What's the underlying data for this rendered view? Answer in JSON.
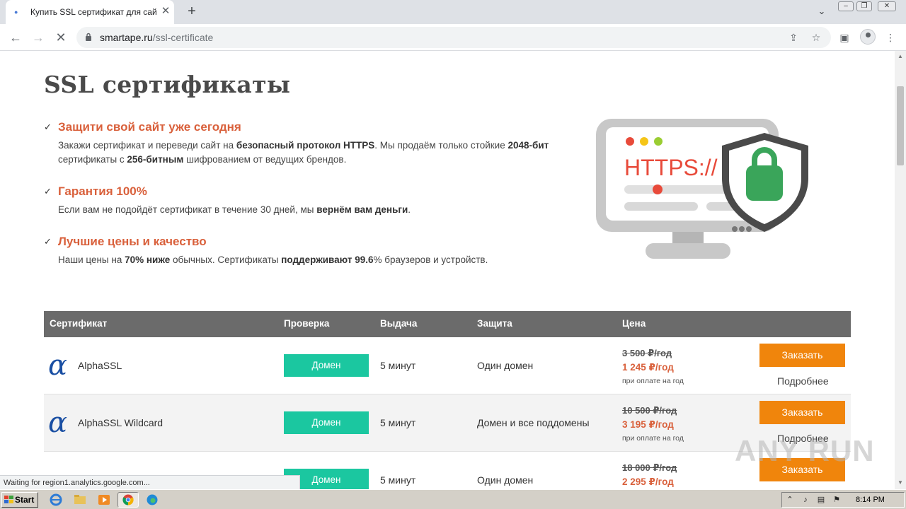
{
  "browser": {
    "tab_title": "Купить SSL сертификат для сайта",
    "url_host": "smartape.ru",
    "url_path": "/ssl-certificate",
    "status_text": "Waiting for region1.analytics.google.com..."
  },
  "page": {
    "title": "SSL сертификаты",
    "features": [
      {
        "title": "Защити свой сайт уже сегодня",
        "text_parts": [
          "Закажи сертификат и переведи сайт на ",
          "безопасный протокол HTTPS",
          ". Мы продаём только стойкие ",
          "2048-бит",
          " сертификаты с ",
          "256-битным",
          " шифрованием от ведущих брендов."
        ]
      },
      {
        "title": "Гарантия 100%",
        "text_parts": [
          "Если вам не подойдёт сертификат в течение 30 дней, мы ",
          "вернём вам деньги",
          "."
        ]
      },
      {
        "title": "Лучшие цены и качество",
        "text_parts": [
          "Наши цены на ",
          "70% ниже",
          " обычных. Сертификаты ",
          "поддерживают 99.6",
          "% браузеров и устройств."
        ]
      }
    ],
    "illustration_text": "HTTPS://",
    "table": {
      "headers": [
        "Сертификат",
        "Проверка",
        "Выдача",
        "Защита",
        "Цена"
      ],
      "rows": [
        {
          "name": "AlphaSSL",
          "check": "Домен",
          "issue": "5 минут",
          "protection": "Один домен",
          "old_price": "3 500 ₽/год",
          "price": "1 245 ₽/год",
          "note": "при оплате на год",
          "order": "Заказать",
          "more": "Подробнее"
        },
        {
          "name": "AlphaSSL Wildcard",
          "check": "Домен",
          "issue": "5 минут",
          "protection": "Домен и все поддомены",
          "old_price": "10 500 ₽/год",
          "price": "3 195 ₽/год",
          "note": "при оплате на год",
          "order": "Заказать",
          "more": "Подробнее"
        },
        {
          "name": "",
          "check": "Домен",
          "issue": "5 минут",
          "protection": "Один домен",
          "old_price": "18 000 ₽/год",
          "price": "2 295 ₽/год",
          "note": "",
          "order": "Заказать",
          "more": ""
        }
      ]
    }
  },
  "watermark": "ANY RUN",
  "taskbar": {
    "start_label": "Start",
    "clock": "8:14 PM"
  },
  "colors": {
    "accent": "#d9603b",
    "badge": "#1bc7a0",
    "order_button": "#f0850c",
    "table_header": "#6b6b6b"
  }
}
